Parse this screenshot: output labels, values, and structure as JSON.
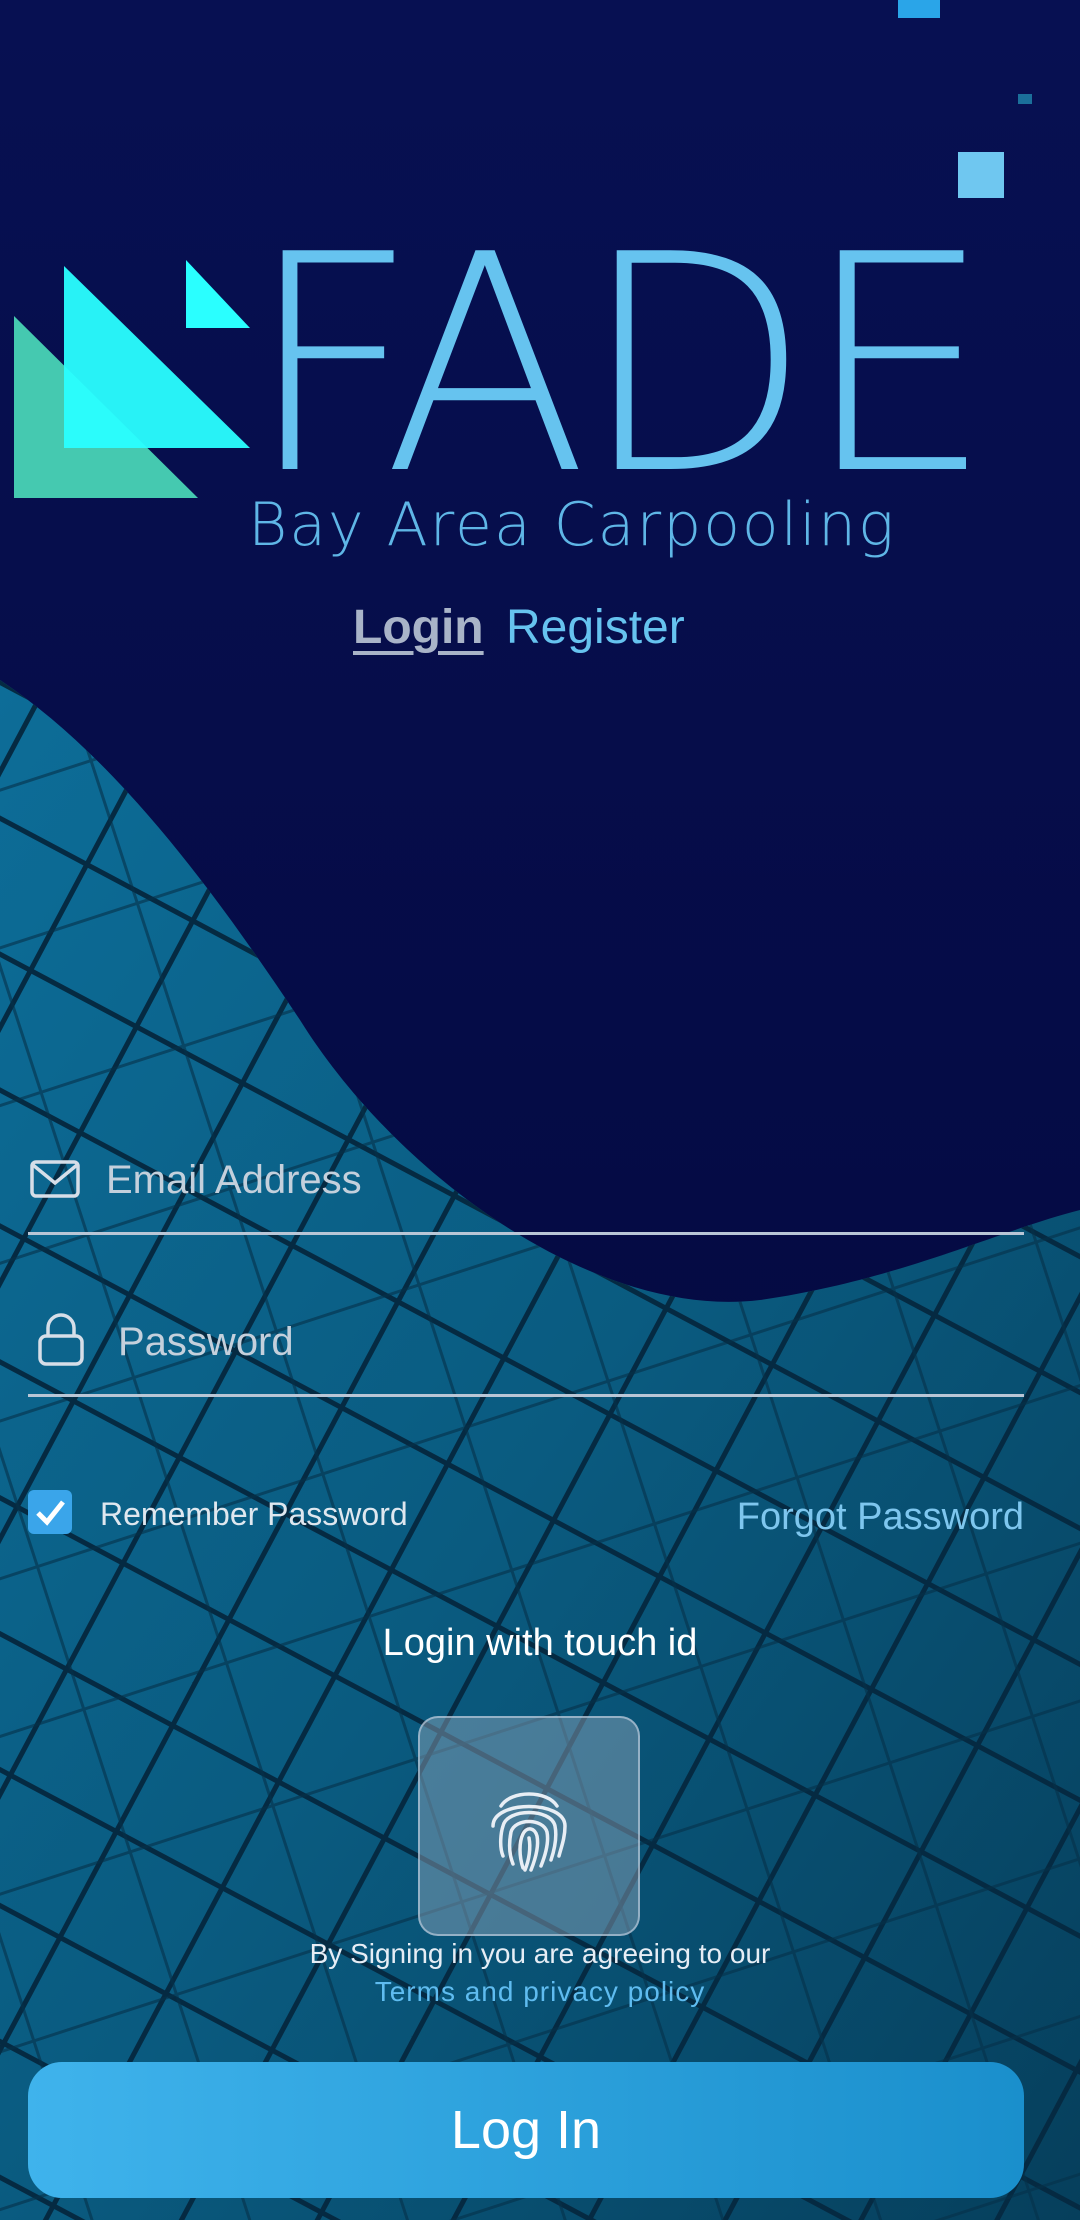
{
  "logo": {
    "word": "FADE",
    "tagline": "Bay Area Carpooling"
  },
  "tabs": {
    "login": "Login",
    "register": "Register",
    "active": "Login"
  },
  "form": {
    "email": {
      "placeholder": "Email Address",
      "value": "",
      "icon": "mail-icon"
    },
    "password": {
      "placeholder": "Password",
      "value": "",
      "icon": "lock-icon"
    },
    "remember_label": "Remember Password",
    "remember_checked": true,
    "forgot_label": "Forgot Password"
  },
  "touch": {
    "title": "Login with touch id",
    "icon": "fingerprint-icon"
  },
  "legal": {
    "agree_text": "By Signing in you are agreeing to our",
    "terms_link": "Terms and privacy policy"
  },
  "submit_label": "Log In",
  "colors": {
    "background_dark": "#05093f",
    "tile_blue": "#0b5f86",
    "accent_cyan": "#2affff",
    "accent_green": "#45c9b0",
    "logo_blue": "#66c3ef",
    "button_blue": "#3fb3ec"
  }
}
